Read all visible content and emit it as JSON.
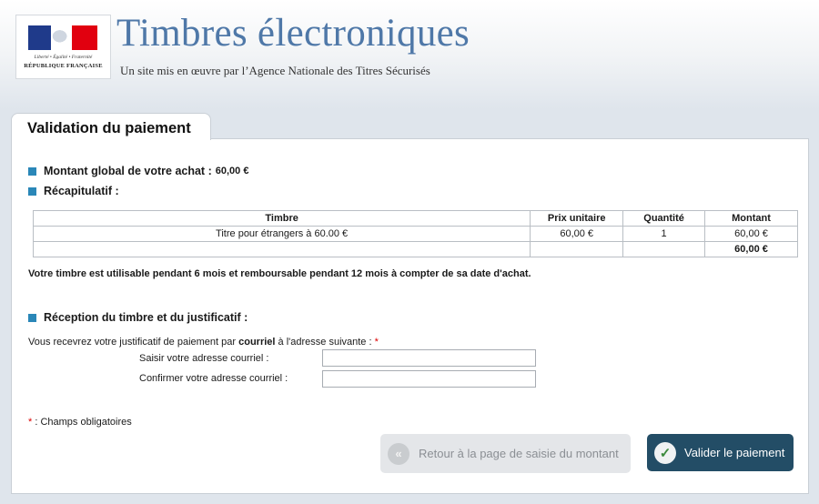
{
  "header": {
    "logo": {
      "motto": "Liberté • Égalité • Fraternité",
      "republic": "RÉPUBLIQUE FRANÇAISE",
      "flag_colors": [
        "#1f3a8a",
        "#ffffff",
        "#e1000f"
      ]
    },
    "title": "Timbres électroniques",
    "subtitle": "Un site mis en œuvre par l’Agence Nationale des Titres Sécurisés"
  },
  "page": {
    "tab_title": "Validation du paiement"
  },
  "summary": {
    "total_label": "Montant global de votre achat :",
    "total_value": "60,00 €",
    "recap_label": "Récapitulatif :",
    "table": {
      "headers": [
        "Timbre",
        "Prix unitaire",
        "Quantité",
        "Montant"
      ],
      "rows": [
        [
          "Titre pour étrangers à 60.00 €",
          "60,00 €",
          "1",
          "60,00 €"
        ]
      ],
      "total": "60,00 €"
    },
    "note": "Votre timbre est utilisable pendant 6 mois et remboursable pendant 12 mois à compter de sa date d'achat."
  },
  "reception": {
    "title": "Réception du timbre et du justificatif :",
    "intro_before": "Vous recevrez votre justificatif de paiement par ",
    "intro_bold": "courriel",
    "intro_after": " à l'adresse suivante : ",
    "required_mark": "*",
    "email_label": "Saisir votre adresse courriel :",
    "email_value": "",
    "confirm_label": "Confirmer votre adresse courriel :",
    "confirm_value": ""
  },
  "legend": {
    "mark": "*",
    "text": " : Champs obligatoires"
  },
  "buttons": {
    "back": {
      "label": "Retour à la page de saisie du montant",
      "icon": "double-chevron-left-icon"
    },
    "validate": {
      "label": "Valider le paiement",
      "icon": "checkmark-icon"
    }
  },
  "colors": {
    "accent_square": "#2a87b8",
    "title": "#4f78a8",
    "validate_button": "#234d66",
    "required": "#dd0000"
  }
}
